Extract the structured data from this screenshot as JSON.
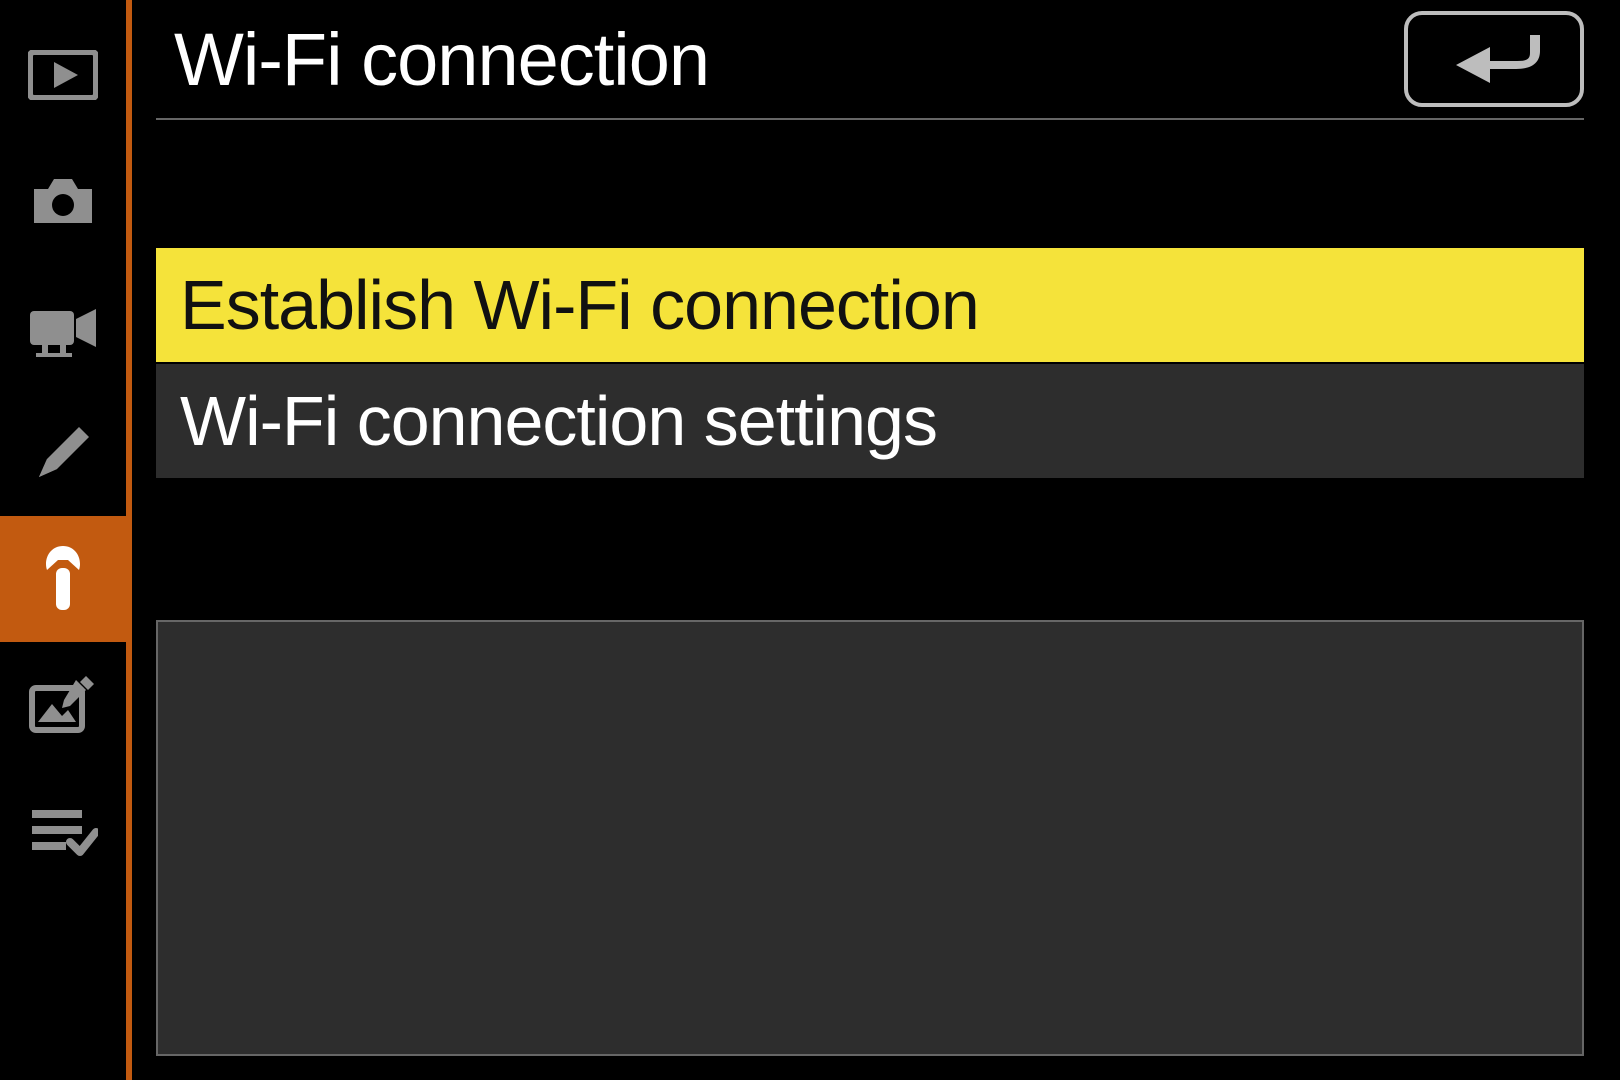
{
  "header": {
    "title": "Wi-Fi connection"
  },
  "menu": {
    "items": [
      {
        "label": "Establish Wi-Fi connection",
        "selected": true
      },
      {
        "label": "Wi-Fi connection settings",
        "selected": false
      }
    ]
  },
  "sidebar": {
    "items": [
      {
        "name": "playback",
        "active": false
      },
      {
        "name": "photo-shooting",
        "active": false
      },
      {
        "name": "video-recording",
        "active": false
      },
      {
        "name": "custom-settings",
        "active": false
      },
      {
        "name": "setup",
        "active": true
      },
      {
        "name": "retouch",
        "active": false
      },
      {
        "name": "my-menu",
        "active": false
      }
    ]
  },
  "colors": {
    "accent": "#c25a10",
    "highlight": "#f5e33a",
    "panel": "#2d2d2d"
  }
}
